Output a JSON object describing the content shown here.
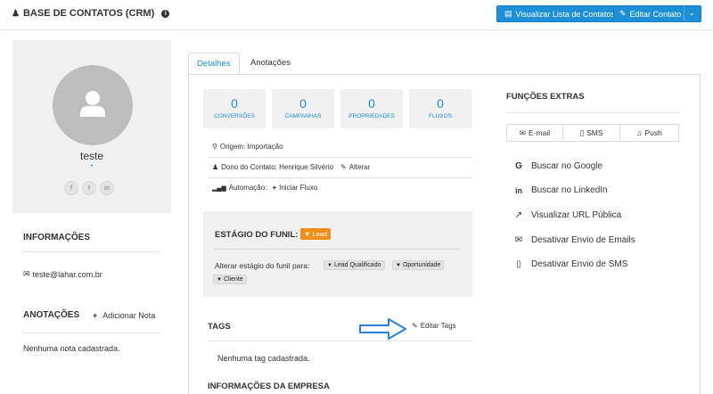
{
  "header": {
    "title": "BASE DE CONTATOS (CRM)",
    "btn_list": "Visualizar Lista de Contatos",
    "btn_edit": "Editar Contato"
  },
  "profile": {
    "name": "teste",
    "dot": "•",
    "social": [
      "f",
      "t",
      "in"
    ]
  },
  "info": {
    "heading": "INFORMAÇÕES",
    "email": "teste@lahar.com.br"
  },
  "notes": {
    "heading": "ANOTAÇÕES",
    "add": "Adicionar Nota",
    "empty": "Nenhuma nota cadastrada."
  },
  "tabs": {
    "details": "Detalhes",
    "notes": "Anotações"
  },
  "stats": [
    {
      "value": "0",
      "label": "CONVERSÕES"
    },
    {
      "value": "0",
      "label": "CAMPANHAS"
    },
    {
      "value": "0",
      "label": "PROPRIEDADES"
    },
    {
      "value": "0",
      "label": "FLUXOS"
    }
  ],
  "meta": {
    "origin": "Origem: Importação",
    "owner": "Dono do Contato: Henrique Silvério",
    "owner_change": "Alterar",
    "automation": "Automação:",
    "automation_start": "Iniciar Fluxo"
  },
  "funnel": {
    "heading": "ESTÁGIO DO FUNIL:",
    "stage": "Lead",
    "change_label": "Alterar estágio do funil para:",
    "options": [
      "Lead Qualificado",
      "Oportunidade",
      "Cliente"
    ]
  },
  "tags": {
    "heading": "TAGS",
    "edit": "Editar Tags",
    "empty": "Nenhuma tag cadastrada."
  },
  "company": {
    "heading": "INFORMAÇÕES DA EMPRESA"
  },
  "extras": {
    "heading": "FUNÇÕES EXTRAS",
    "channels": [
      "E-mail",
      "SMS",
      "Push"
    ],
    "items": [
      "Buscar no Google",
      "Buscar no LinkedIn",
      "Visualizar URL Pública",
      "Desativar Envio de Emails",
      "Desativar Envio de SMS"
    ]
  },
  "colors": {
    "accent": "#1c8fd6",
    "lead": "#f0901a",
    "arrow": "#2a7fd4"
  }
}
